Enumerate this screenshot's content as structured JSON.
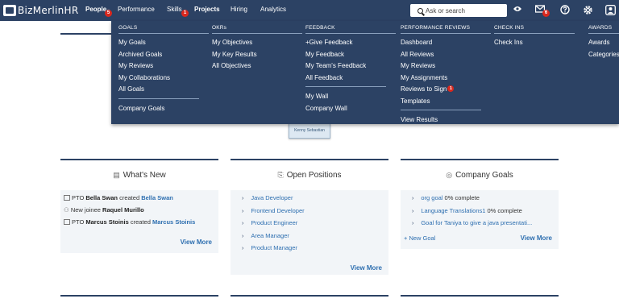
{
  "brand": {
    "logo_text": "BizMerlinHR"
  },
  "nav": {
    "items": [
      {
        "label": "People",
        "badge": "5"
      },
      {
        "label": "Performance"
      },
      {
        "label": "Skills",
        "badge": "1"
      },
      {
        "label": "Projects"
      },
      {
        "label": "Hiring"
      },
      {
        "label": "Analytics"
      }
    ],
    "search_placeholder": "Ask or search",
    "mail_badge": "6"
  },
  "icons": [
    "search-icon",
    "visibility-icon",
    "mail-icon",
    "help-icon",
    "settings-icon",
    "user-icon"
  ],
  "colors": {
    "nav_bg": "#2c4264",
    "badge": "#d9281e",
    "link": "#2e6fb0"
  },
  "mega_menu": {
    "columns": [
      {
        "header": "GOALS",
        "items": [
          "My Goals",
          "Archived Goals",
          "My Reviews",
          "My Collaborations",
          "All Goals",
          "Company Goals"
        ]
      },
      {
        "header": "OKRs",
        "items": [
          "My Objectives",
          "My Key Results",
          "All Objectives"
        ]
      },
      {
        "header": "FEEDBACK",
        "items": [
          "+Give Feedback",
          "My Feedback",
          "My Team's Feedback",
          "All Feedback",
          "My Wall",
          "Company Wall"
        ]
      },
      {
        "header": "PERFORMANCE REVIEWS",
        "items": [
          "Dashboard",
          "All Reviews",
          "My Reviews",
          "My Assignments",
          "Reviews to Sign",
          "Templates",
          "View Results"
        ],
        "badge": "1"
      },
      {
        "header": "CHECK INS",
        "items": [
          "Check Ins"
        ]
      },
      {
        "header": "AWARDS",
        "items": [
          "Awards",
          "Categories"
        ]
      }
    ]
  },
  "tooltip": {
    "name": "Kenny Sebastian"
  },
  "cards": {
    "whats_new": {
      "title": "What's New",
      "items": [
        {
          "prefix": "PTO",
          "actor": "Bella Swan",
          "verb": "created",
          "target": "Bella Swan"
        },
        {
          "prefix": "New joinee",
          "actor": "Raquel Murillo"
        },
        {
          "prefix": "PTO",
          "actor": "Marcus Stoinis",
          "verb": "created",
          "target": "Marcus Stoinis"
        }
      ],
      "view_more": "View More"
    },
    "open_positions": {
      "title": "Open Positions",
      "items": [
        "Java Developer",
        "Frontend Developer",
        "Product Engineer",
        "Area Manager",
        "Product Manager"
      ],
      "view_more": "View More"
    },
    "company_goals": {
      "title": "Company Goals",
      "items": [
        {
          "name": "org goal",
          "progress": "0% complete"
        },
        {
          "name": "Language Translations1",
          "progress": "0% complete"
        },
        {
          "name": "Goal for Taniya to give a java presentati..."
        }
      ],
      "new_goal": "+ New Goal",
      "view_more": "View More"
    }
  }
}
